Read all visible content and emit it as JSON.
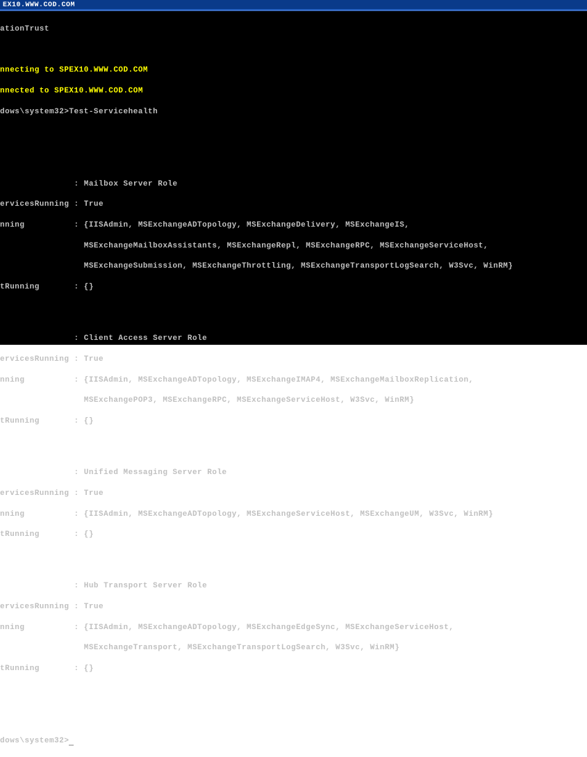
{
  "titlebar": "EX10.WWW.COD.COM",
  "post_title": "ationTrust",
  "connect_in": "nnecting to SPEX10.WWW.COD.COM",
  "connect_done": "nnected to SPEX10.WWW.COD.COM",
  "prompt1_path": "dows\\system32>",
  "prompt1_cmd": "Test-Servicehealth",
  "label_role": "               : ",
  "label_services_running": "ervicesRunning : ",
  "label_nning": "nning          : ",
  "label_not_running": "tRunning       : ",
  "roles": [
    {
      "name": "Mailbox Server Role",
      "running": "True",
      "services_l1": "{IISAdmin, MSExchangeADTopology, MSExchangeDelivery, MSExchangeIS,",
      "services_l2": "                 MSExchangeMailboxAssistants, MSExchangeRepl, MSExchangeRPC, MSExchangeServiceHost,",
      "services_l3": "                 MSExchangeSubmission, MSExchangeThrottling, MSExchangeTransportLogSearch, W3Svc, WinRM}",
      "not_running": "{}"
    },
    {
      "name": "Client Access Server Role",
      "running": "True",
      "services_l1": "{IISAdmin, MSExchangeADTopology, MSExchangeIMAP4, MSExchangeMailboxReplication,",
      "services_l2": "                 MSExchangePOP3, MSExchangeRPC, MSExchangeServiceHost, W3Svc, WinRM}",
      "services_l3": "",
      "not_running": "{}"
    },
    {
      "name": "Unified Messaging Server Role",
      "running": "True",
      "services_l1": "{IISAdmin, MSExchangeADTopology, MSExchangeServiceHost, MSExchangeUM, W3Svc, WinRM}",
      "services_l2": "",
      "services_l3": "",
      "not_running": "{}"
    },
    {
      "name": "Hub Transport Server Role",
      "running": "True",
      "services_l1": "{IISAdmin, MSExchangeADTopology, MSExchangeEdgeSync, MSExchangeServiceHost,",
      "services_l2": "                 MSExchangeTransport, MSExchangeTransportLogSearch, W3Svc, WinRM}",
      "services_l3": "",
      "not_running": "{}"
    }
  ],
  "prompt2_path": "dows\\system32>"
}
